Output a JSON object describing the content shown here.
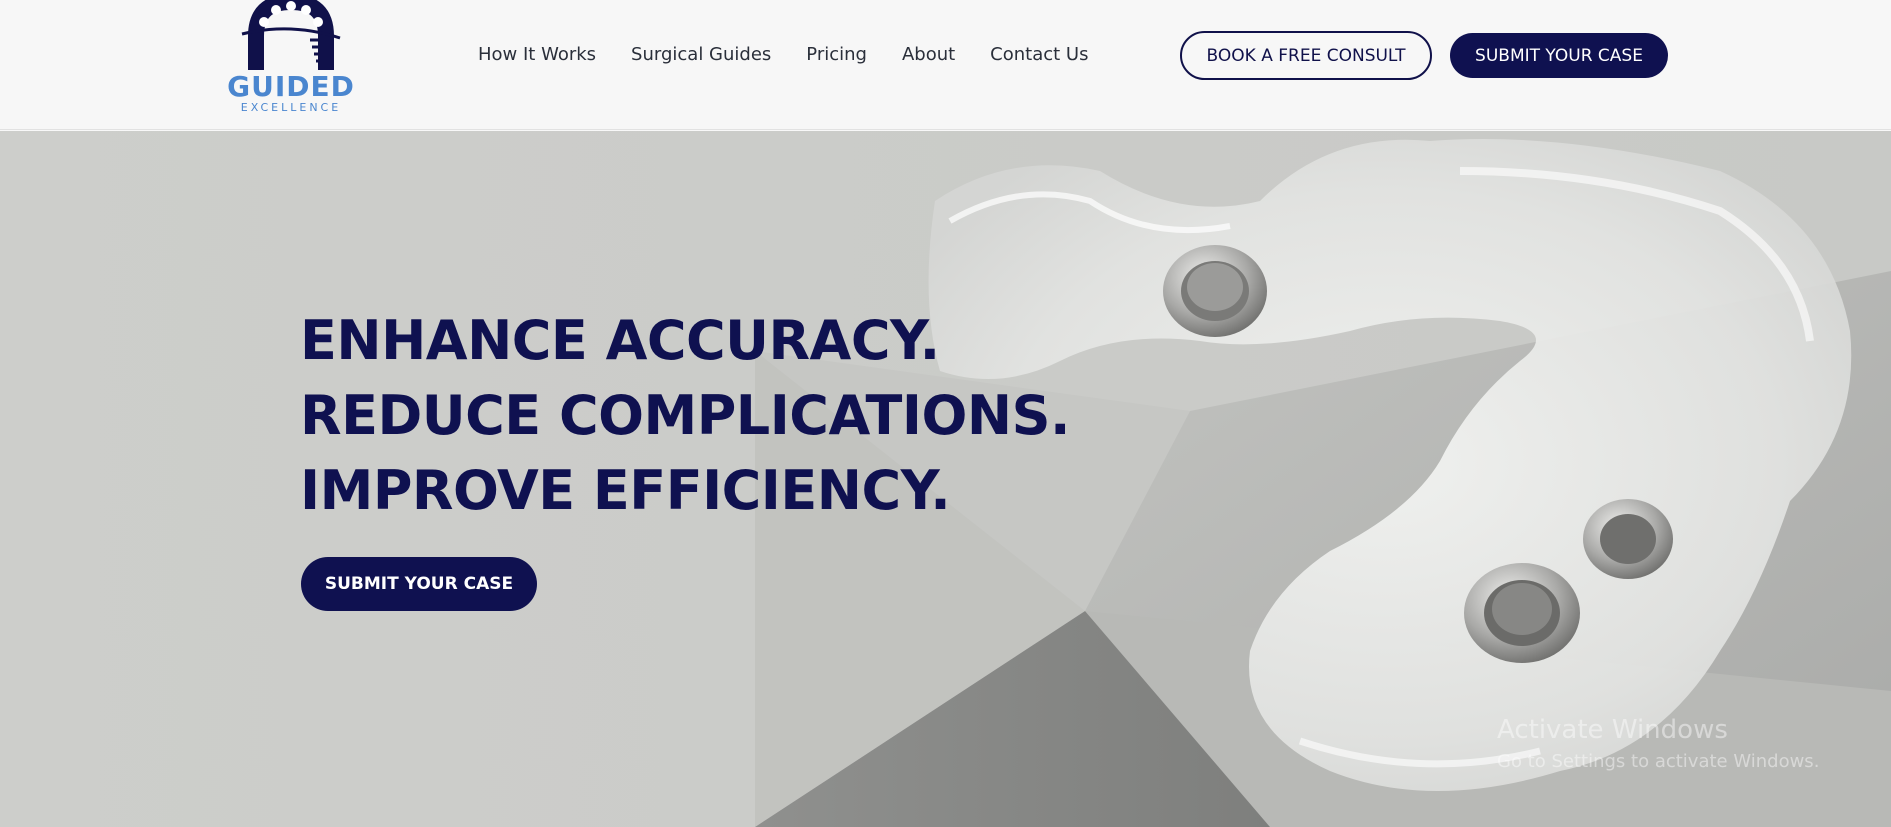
{
  "brand": {
    "name": "GUIDED",
    "tagline": "EXCELLENCE",
    "primary_color": "#0f1150",
    "accent_color": "#4a86cf"
  },
  "nav": {
    "items": [
      "How It Works",
      "Surgical Guides",
      "Pricing",
      "About",
      "Contact Us"
    ]
  },
  "header_actions": {
    "consult_label": "BOOK A FREE CONSULT",
    "submit_label": "SUBMIT YOUR CASE"
  },
  "hero": {
    "headline": [
      "ENHANCE ACCURACY.",
      "REDUCE COMPLICATIONS.",
      "IMPROVE EFFICIENCY."
    ],
    "cta_label": "SUBMIT YOUR CASE",
    "image": "dental-surgical-guide-photo"
  },
  "os_watermark": {
    "title": "Activate Windows",
    "subtitle": "Go to Settings to activate Windows."
  }
}
